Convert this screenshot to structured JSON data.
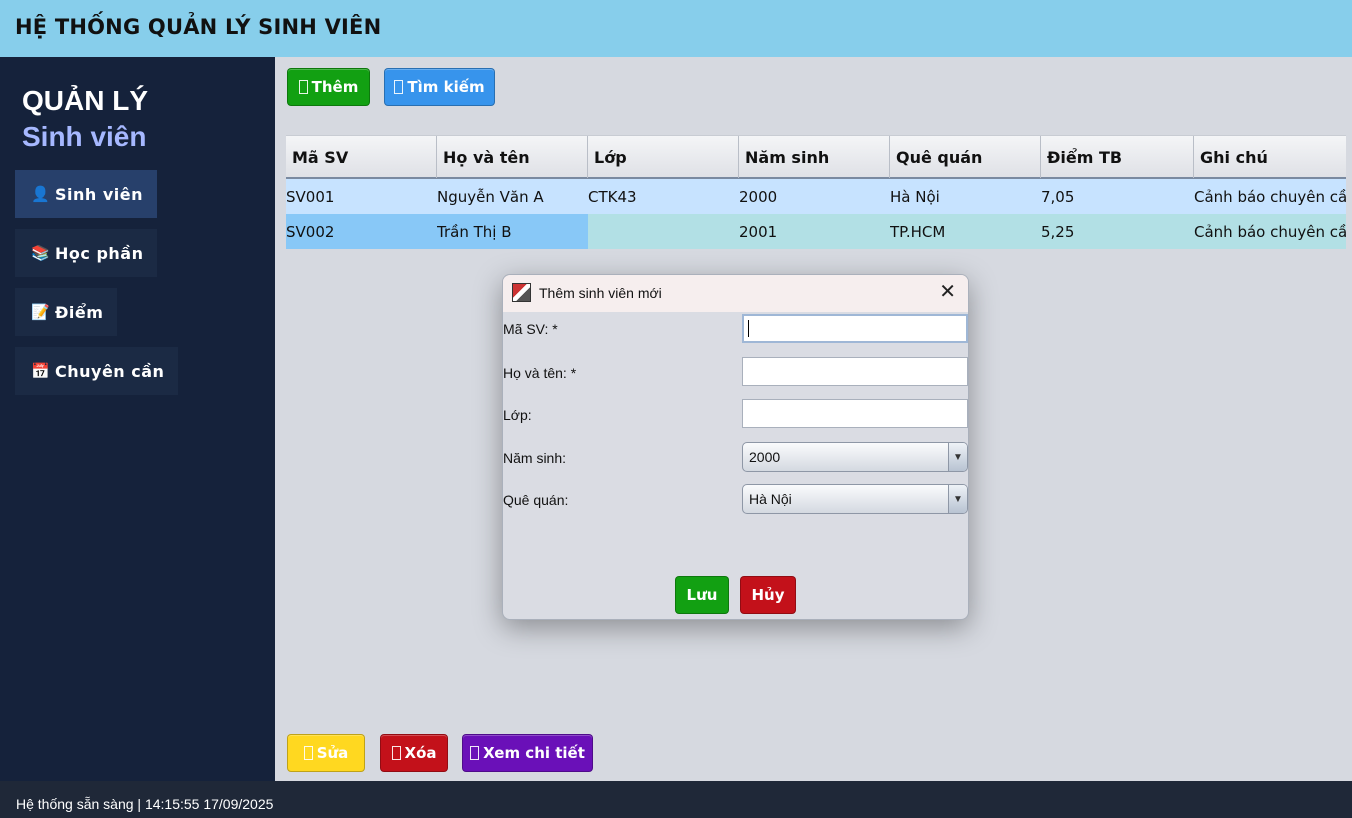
{
  "header": {
    "title": "HỆ THỐNG QUẢN LÝ SINH VIÊN"
  },
  "sidebar": {
    "title": "QUẢN LÝ",
    "subtitle": "Sinh viên",
    "items": [
      {
        "icon": "👤",
        "label": "Sinh viên"
      },
      {
        "icon": "📚",
        "label": "Học phần"
      },
      {
        "icon": "📝",
        "label": "Điểm"
      },
      {
        "icon": "📅",
        "label": "Chuyên cần"
      }
    ]
  },
  "toolbar": {
    "add": {
      "icon": "",
      "label": "Thêm",
      "color": "#12a012"
    },
    "search": {
      "icon": "",
      "label": "Tìm kiếm",
      "color": "#3794ec"
    }
  },
  "table": {
    "columns": [
      "Mã SV",
      "Họ và tên",
      "Lớp",
      "Năm sinh",
      "Quê quán",
      "Điểm TB",
      "Ghi chú"
    ],
    "rows": [
      [
        "SV001",
        "Nguyễn Văn A",
        "CTK43",
        "2000",
        "Hà Nội",
        "7,05",
        "Cảnh báo chuyên cầ..."
      ],
      [
        "SV002",
        "Trần Thị B",
        "",
        "2001",
        "TP.HCM",
        "5,25",
        "Cảnh báo chuyên cầ..."
      ]
    ]
  },
  "bottom_actions": {
    "edit": {
      "label": "Sửa",
      "color": "#ffd820"
    },
    "delete": {
      "label": "Xóa",
      "color": "#c3111a"
    },
    "details": {
      "label": "Xem chi tiết",
      "color": "#6a10b8"
    }
  },
  "dialog": {
    "title": "Thêm sinh viên mới",
    "fields": {
      "ma_sv": {
        "label": "Mã SV: *",
        "value": ""
      },
      "ho_ten": {
        "label": "Họ và tên: *",
        "value": ""
      },
      "lop": {
        "label": "Lớp:",
        "value": ""
      },
      "nam_sinh": {
        "label": "Năm sinh:",
        "value": "2000"
      },
      "que_quan": {
        "label": "Quê quán:",
        "value": "Hà Nội"
      }
    },
    "save_label": "Lưu",
    "cancel_label": "Hủy",
    "close_symbol": "✕"
  },
  "status": {
    "text": "Hệ thống sẵn sàng | 14:15:55 17/09/2025"
  }
}
